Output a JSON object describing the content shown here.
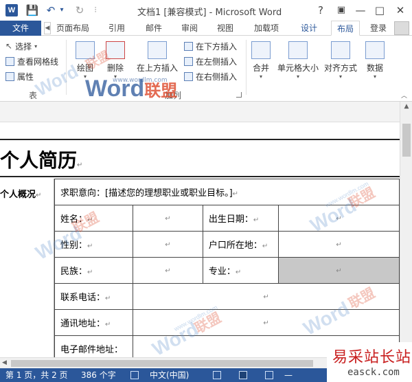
{
  "window": {
    "title": "文档1 [兼容模式] - Microsoft Word",
    "logo": "W",
    "help": "?",
    "controls": {
      "restore": "▣",
      "minimize": "—",
      "maximize": "□",
      "close": "✕"
    }
  },
  "quick_access": {
    "save": "💾",
    "undo": "↶",
    "undo_dropdown": "▾",
    "redo": "↻",
    "customize": "⫶"
  },
  "tabs": {
    "file": "文件",
    "items": [
      "页面布局",
      "引用",
      "邮件",
      "审阅",
      "视图",
      "加载项",
      "设计",
      "布局"
    ],
    "active": "布局",
    "login": "登录"
  },
  "ribbon": {
    "table_group": {
      "select": "选择",
      "gridlines": "查看网格线",
      "properties": "属性",
      "label": "表"
    },
    "draw": "绘图",
    "delete": "删除",
    "insert_above": "在上方插入",
    "insert_below": "在下方插入",
    "insert_left": "在左侧插入",
    "insert_right": "在右侧插入",
    "rows_cols_label": "加列",
    "merge": "合并",
    "cell_size": "单元格大小",
    "alignment": "对齐方式",
    "data": "数据"
  },
  "document": {
    "heading": "个人简历",
    "section": "个人概况",
    "paragraph_mark": "↵",
    "objective": "求职意向：[描述您的理想职业或职业目标。]",
    "rows": [
      {
        "l1": "姓名：",
        "l2": "出生日期："
      },
      {
        "l1": "性别：",
        "l2": "户口所在地："
      },
      {
        "l1": "民族：",
        "l2": "专业："
      }
    ],
    "contact": [
      "联系电话：",
      "通讯地址：",
      "电子邮件地址："
    ]
  },
  "watermark": {
    "brand": "Word",
    "brand_cn": "联盟",
    "url": "www.wordlm.com"
  },
  "status": {
    "page": "第 1 页，共 2 页",
    "words": "386 个字",
    "lang": "中文(中国)"
  },
  "site_logo": {
    "cn": "易采站长站",
    "url": "easck.com"
  }
}
